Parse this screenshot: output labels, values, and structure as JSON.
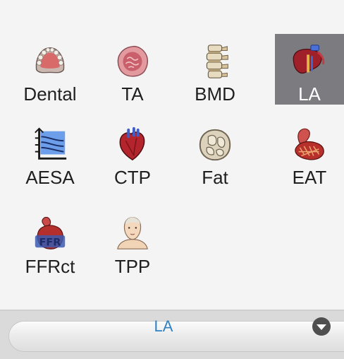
{
  "top_row": {
    "labels": [
      "",
      "",
      "",
      ""
    ]
  },
  "tools": [
    {
      "id": "dental",
      "label": "Dental",
      "icon": "dental-icon"
    },
    {
      "id": "ta",
      "label": "TA",
      "icon": "tissue-icon"
    },
    {
      "id": "bmd",
      "label": "BMD",
      "icon": "spine-icon"
    },
    {
      "id": "la",
      "label": "LA",
      "icon": "liver-icon",
      "selected": true
    },
    {
      "id": "aesa",
      "label": "AESA",
      "icon": "chart-icon"
    },
    {
      "id": "ctp",
      "label": "CTP",
      "icon": "heart-icon"
    },
    {
      "id": "fat",
      "label": "Fat",
      "icon": "fat-cross-section-icon"
    },
    {
      "id": "eat",
      "label": "EAT",
      "icon": "epicardial-fat-icon"
    },
    {
      "id": "ffrct",
      "label": "FFRct",
      "icon": "ffr-heart-icon"
    },
    {
      "id": "tpp",
      "label": "TPP",
      "icon": "head-icon"
    }
  ],
  "selector": {
    "value": "LA",
    "icon": "chevron-down-icon"
  },
  "colors": {
    "selected_tile": "#7b7b80",
    "selector_text": "#2f82c6",
    "panel_bg": "#f4f4f4"
  }
}
